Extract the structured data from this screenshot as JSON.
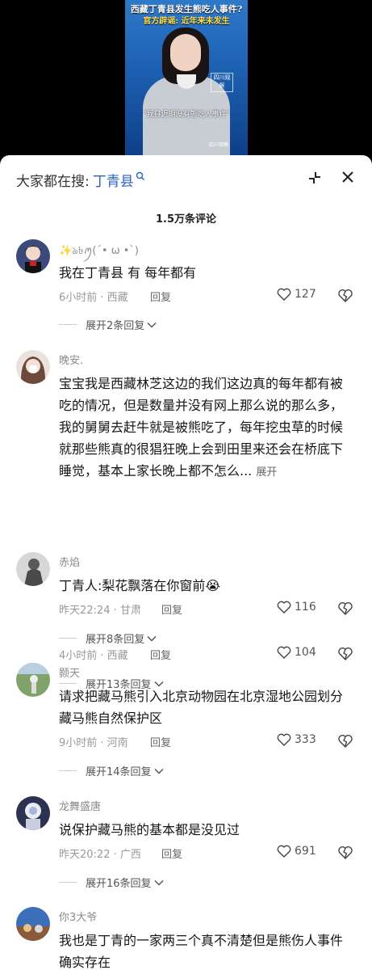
{
  "video": {
    "headline_line1": "西藏丁青县发生熊吃人事件?",
    "headline_line2": "官方辟谣: 近年来未发生",
    "subtitle": "\"我县近期没有熊吃人事件\"",
    "logo_tag": "四川观察",
    "corner_logo": "四川观察"
  },
  "panel": {
    "search_prefix": "大家都在搜:",
    "search_term": "丁青县",
    "comment_count": "1.5万条评论",
    "accent_color": "#2a63c7"
  },
  "comments": [
    {
      "user": "✨ঌ৳ꪑ(´• ω •`)",
      "text": "我在丁青县 有 每年都有",
      "time_location": "6小时前 · 西藏",
      "reply_label": "回复",
      "likes": "127",
      "more_replies": "展开2条回复"
    },
    {
      "user": "晚安.",
      "text": "宝宝我是西藏林芝这边的我们这边真的每年都有被吃的情况，但是数量并没有网上那么说的那么多，我的舅舅去赶牛就是被熊吃了，每年挖虫草的时候就那些熊真的很猖狂晚上会到田里来还会在桥底下睡觉，基本上家长晚上都不怎么...",
      "expand_label": "展开",
      "time_location": "4小时前 · 西藏",
      "reply_label": "回复",
      "likes": "104",
      "more_replies": "展开13条回复"
    },
    {
      "user": "赤焰",
      "text": "丁青人:梨花飘落在你窗前😭",
      "time_location": "昨天22:24 · 甘肃",
      "reply_label": "回复",
      "likes": "116",
      "more_replies": "展开8条回复"
    },
    {
      "user": "颢天",
      "text": "请求把藏马熊引入北京动物园在北京湿地公园划分藏马熊自然保护区",
      "time_location": "9小时前 · 河南",
      "reply_label": "回复",
      "likes": "333",
      "more_replies": "展开14条回复"
    },
    {
      "user": "龙舞盛唐",
      "text": "说保护藏马熊的基本都是没见过",
      "time_location": "昨天20:22 · 广西",
      "reply_label": "回复",
      "likes": "691",
      "more_replies": "展开16条回复"
    },
    {
      "user": "你3大爷",
      "text": "我也是丁青的一家两三个真不清楚但是熊伤人事件确实存在"
    }
  ]
}
